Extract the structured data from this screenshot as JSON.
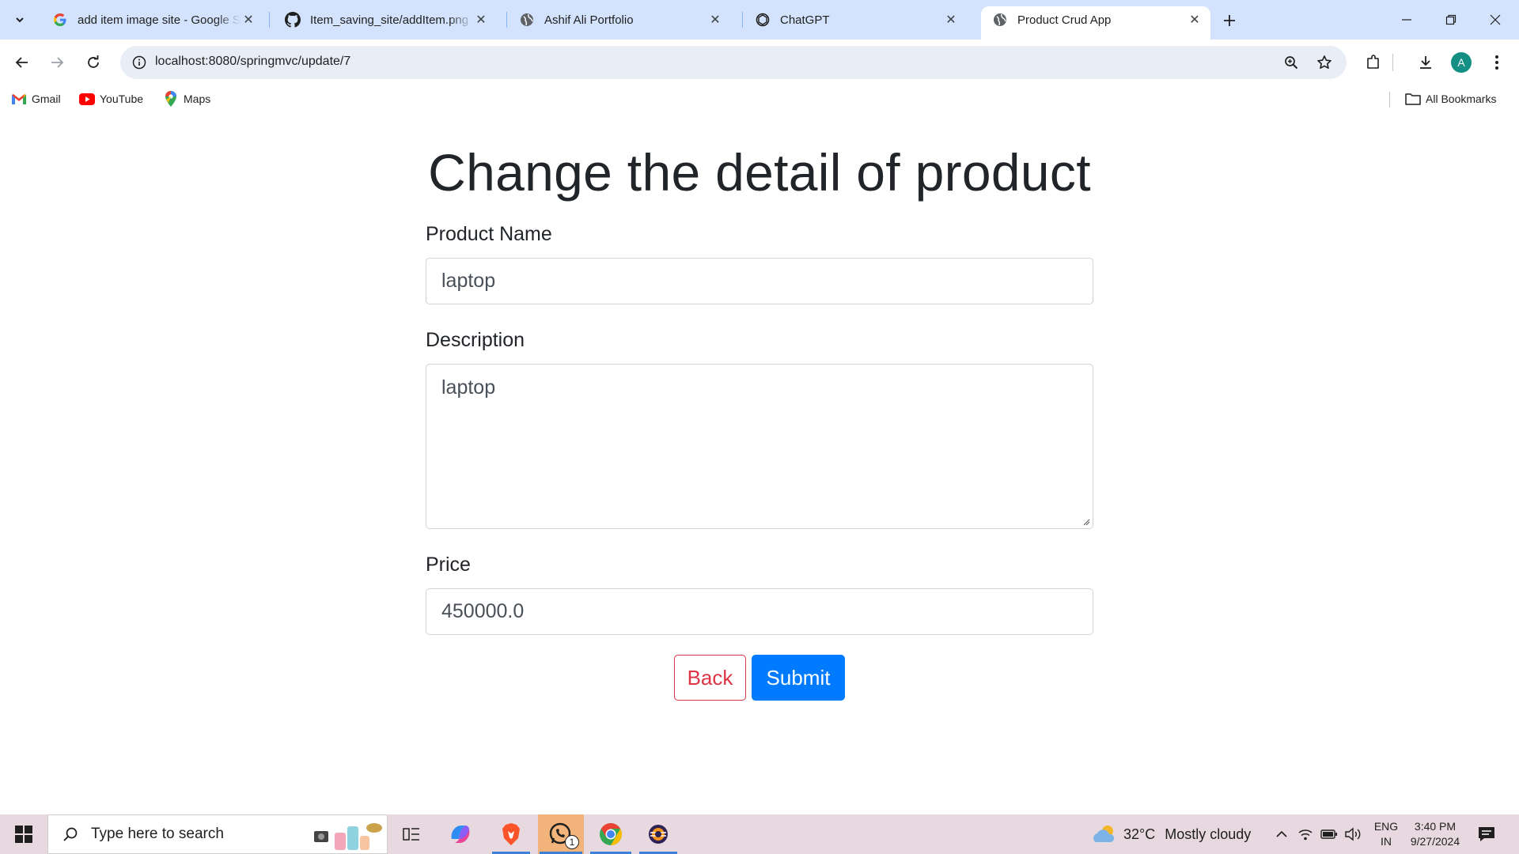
{
  "browser": {
    "tabs": [
      {
        "title": "add item image site - Google Se",
        "favicon": "google-icon"
      },
      {
        "title": "Item_saving_site/addItem.png a",
        "favicon": "github-icon"
      },
      {
        "title": "Ashif Ali Portfolio",
        "favicon": "globe-icon"
      },
      {
        "title": "ChatGPT",
        "favicon": "chatgpt-icon"
      },
      {
        "title": "Product Crud App",
        "favicon": "globe-icon",
        "active": true
      }
    ],
    "url": "localhost:8080/springmvc/update/7",
    "avatar_letter": "A",
    "bookmarks": [
      {
        "label": "Gmail",
        "icon": "gmail-icon"
      },
      {
        "label": "YouTube",
        "icon": "youtube-icon"
      },
      {
        "label": "Maps",
        "icon": "maps-icon"
      }
    ],
    "all_bookmarks_label": "All Bookmarks"
  },
  "form": {
    "heading": "Change the detail of product",
    "name_label": "Product Name",
    "name_value": "laptop",
    "description_label": "Description",
    "description_value": "laptop",
    "price_label": "Price",
    "price_value": "450000.0",
    "back_label": "Back",
    "submit_label": "Submit"
  },
  "colors": {
    "back_button": "#dc3545",
    "submit_button": "#007bff",
    "tabstrip": "#d3e3fd",
    "taskbar": "#e7d9df"
  },
  "taskbar": {
    "search_placeholder": "Type here to search",
    "weather_temp": "32°C",
    "weather_text": "Mostly cloudy",
    "lang_line1": "ENG",
    "lang_line2": "IN",
    "time": "3:40 PM",
    "date": "9/27/2024",
    "whatsapp_badge": "1"
  }
}
